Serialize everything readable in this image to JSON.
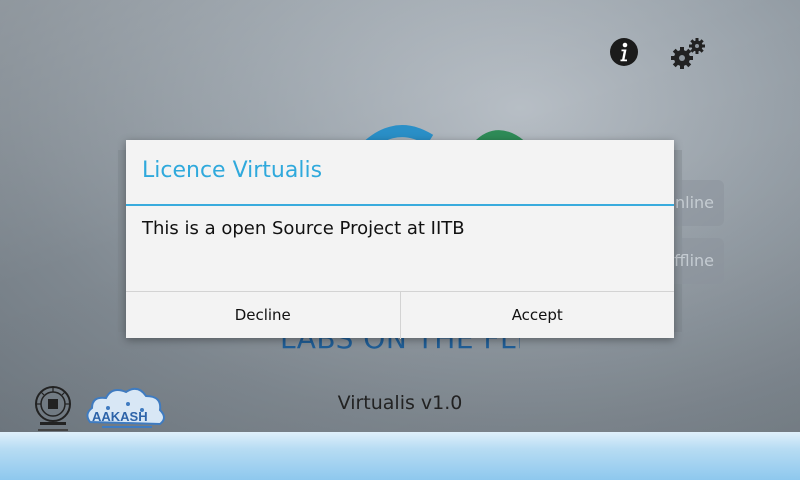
{
  "background": {
    "labs_title": "LABS ON THE FLY",
    "version": "Virtualis v1.0",
    "side_buttons": [
      {
        "label": "nline"
      },
      {
        "label": "ffline"
      }
    ]
  },
  "top_icons": {
    "info": "info-icon",
    "settings": "gear-icon"
  },
  "logos": {
    "iitb": "IIT Bombay",
    "aakash": "AAKASH"
  },
  "dialog": {
    "title": "Licence Virtualis",
    "message": "This is a open Source Project at IITB",
    "buttons": {
      "decline": "Decline",
      "accept": "Accept"
    }
  },
  "colors": {
    "accent": "#2fa9dc",
    "title_blue": "#1f5d96"
  }
}
